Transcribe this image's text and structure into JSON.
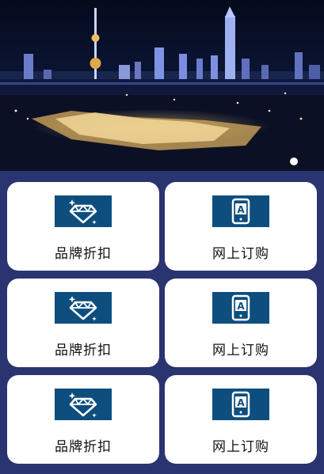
{
  "banner": {
    "image_description": "Night skyline of Shanghai with illuminated towers and a lit riverside complex",
    "pager": {
      "total": 1,
      "active": 1
    }
  },
  "cards": [
    {
      "label": "品牌折扣",
      "icon": "diamond-icon"
    },
    {
      "label": "网上订购",
      "icon": "tablet-a-icon"
    },
    {
      "label": "品牌折扣",
      "icon": "diamond-icon"
    },
    {
      "label": "网上订购",
      "icon": "tablet-a-icon"
    },
    {
      "label": "品牌折扣",
      "icon": "diamond-icon"
    },
    {
      "label": "网上订购",
      "icon": "tablet-a-icon"
    }
  ],
  "colors": {
    "background": "#2a3470",
    "card": "#ffffff",
    "icon_tile": "#0e4e7e",
    "label": "#111111"
  }
}
